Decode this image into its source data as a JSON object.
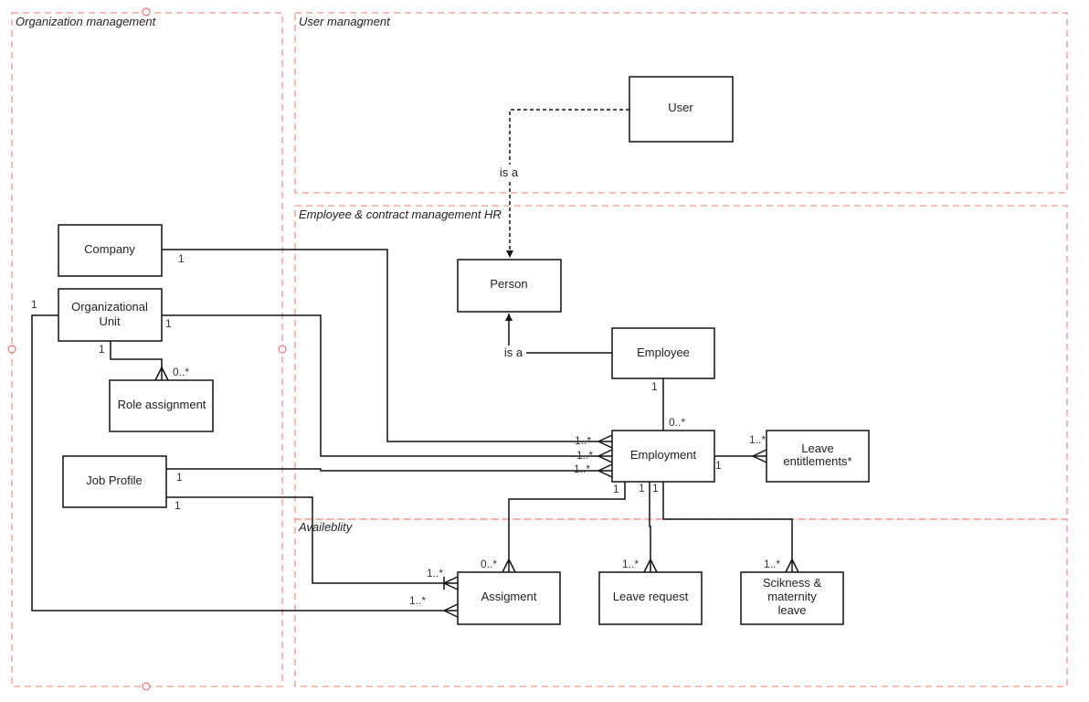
{
  "zones": {
    "organization": "Organization management",
    "user": "User managment",
    "employee": "Employee & contract management HR",
    "availability": "Availeblity"
  },
  "entities": {
    "user": "User",
    "person": "Person",
    "company": "Company",
    "org_unit_1": "Organizational",
    "org_unit_2": "Unit",
    "role_assignment": "Role assignment",
    "job_profile": "Job Profile",
    "employee": "Employee",
    "employment": "Employment",
    "leave_entitlements_1": "Leave",
    "leave_entitlements_2": "entitlements*",
    "assignment": "Assigment",
    "leave_request": "Leave request",
    "sickness_1": "Scikness &",
    "sickness_2": "maternity",
    "sickness_3": "leave"
  },
  "relations": {
    "user_person": "is a",
    "employee_person": "is a",
    "company_employment": [
      "1",
      "1..*"
    ],
    "orgunit_employment": [
      "1",
      "1..*"
    ],
    "jobprofile_employment": [
      "1",
      "1..*"
    ],
    "jobprofile_assignment": [
      "1",
      "1..*"
    ],
    "orgunit_assignment": [
      "1",
      "1..*"
    ],
    "orgunit_role": [
      "1",
      "0..*"
    ],
    "employee_employment": [
      "1",
      "0..*"
    ],
    "employment_leave_entitlements": [
      "1",
      "1..*"
    ],
    "employment_assignment": [
      "1",
      "0..*"
    ],
    "employment_leave_request": [
      "1",
      "1..*"
    ],
    "employment_sickness": [
      "1",
      "1..*"
    ]
  }
}
